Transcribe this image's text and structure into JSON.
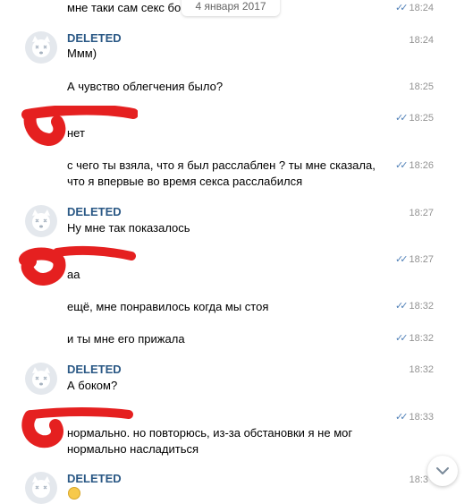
{
  "date_separator": "4 января 2017",
  "sender_name": "DELETED",
  "colors": {
    "link_blue": "#2a5885",
    "check_blue": "#5181b8",
    "redaction_red": "#e52020",
    "time_gray": "#939393"
  },
  "icons": {
    "read_checks": "double-check-icon",
    "scroll_down": "chevron-down-icon",
    "avatar": "deleted-dog-avatar-icon",
    "emoji": "emoji-icon"
  },
  "messages": [
    {
      "text": "мне таки сам секс бо",
      "time": "18:24"
    },
    {
      "text": "Ммм)",
      "time": "18:24"
    },
    {
      "text": "А чувство облегчения было?",
      "time": "18:25"
    },
    {
      "text": "нет",
      "time": "18:25"
    },
    {
      "text": "с чего ты взяла, что я был расслаблен ? ты мне сказала,",
      "text2": "что я впервые во время секса расслабился",
      "time": "18:26"
    },
    {
      "text": "Ну мне так показалось",
      "time": "18:27"
    },
    {
      "text": "аа",
      "time": "18:27"
    },
    {
      "text": "ещё, мне понравилось когда мы стоя",
      "time": "18:32"
    },
    {
      "text": "и ты мне его прижала",
      "time": "18:32"
    },
    {
      "text": "А боком?",
      "time": "18:32"
    },
    {
      "text": "нормально. но повторюсь, из-за обстановки я не мог",
      "text2": "нормально насладиться",
      "time": "18:33"
    },
    {
      "text": "",
      "time": "18:3"
    }
  ]
}
